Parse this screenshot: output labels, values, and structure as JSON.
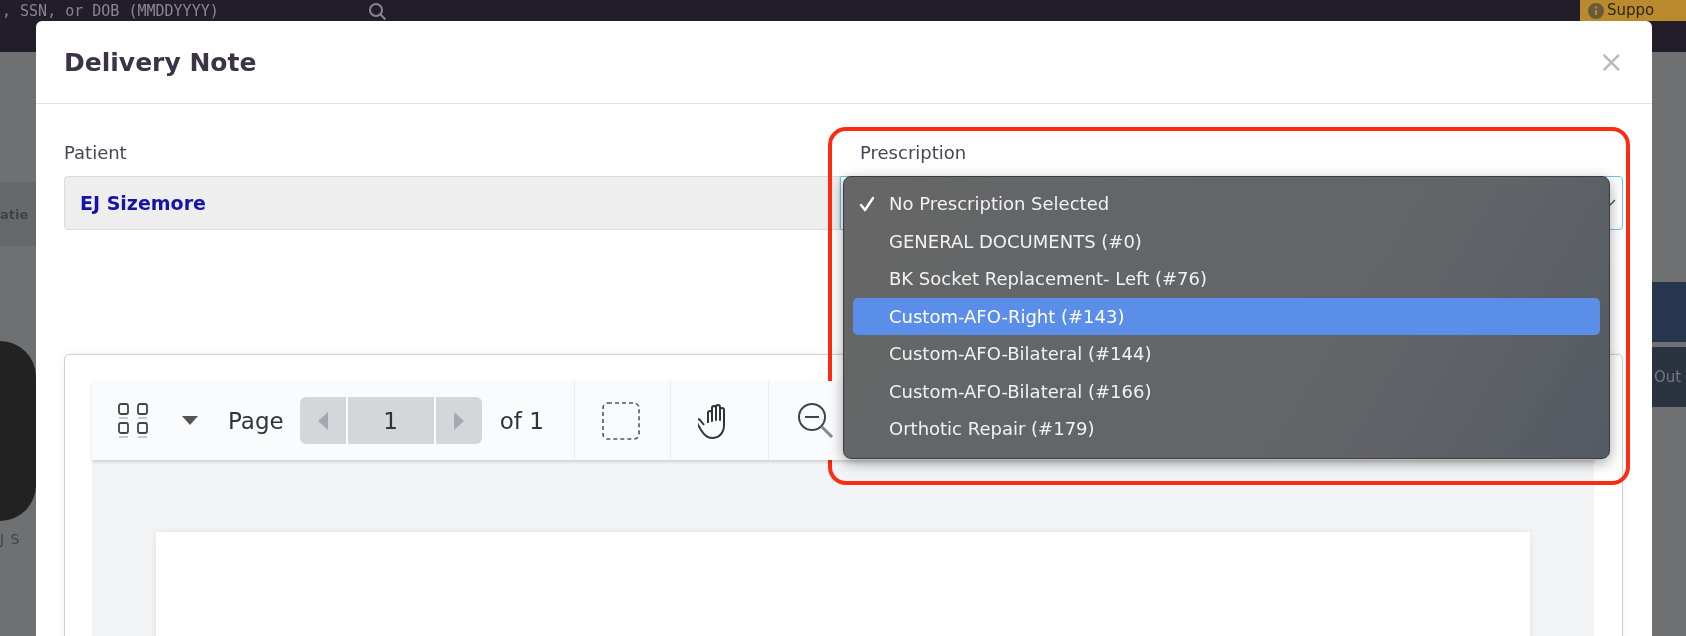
{
  "background_page": {
    "search_placeholder": ", SSN, or DOB (MMDDYYYY)",
    "support_button": "Suppo",
    "tab_fragment": "atie",
    "name_fragment": "J S",
    "side_button_fragment": "Out"
  },
  "modal": {
    "title": "Delivery Note",
    "close": "×"
  },
  "patient": {
    "label": "Patient",
    "value": "EJ Sizemore"
  },
  "prescription": {
    "label": "Prescription",
    "expanded": true,
    "options": [
      {
        "label": "No Prescription Selected",
        "selected": true,
        "highlighted": false
      },
      {
        "label": "GENERAL DOCUMENTS (#0)",
        "selected": false,
        "highlighted": false
      },
      {
        "label": "BK Socket Replacement- Left (#76)",
        "selected": false,
        "highlighted": false
      },
      {
        "label": "Custom-AFO-Right (#143)",
        "selected": false,
        "highlighted": true
      },
      {
        "label": "Custom-AFO-Bilateral (#144)",
        "selected": false,
        "highlighted": false
      },
      {
        "label": "Custom-AFO-Bilateral (#166)",
        "selected": false,
        "highlighted": false
      },
      {
        "label": "Orthotic Repair (#179)",
        "selected": false,
        "highlighted": false
      }
    ]
  },
  "viewer": {
    "page_label": "Page",
    "page": "1",
    "page_count": "of 1"
  }
}
